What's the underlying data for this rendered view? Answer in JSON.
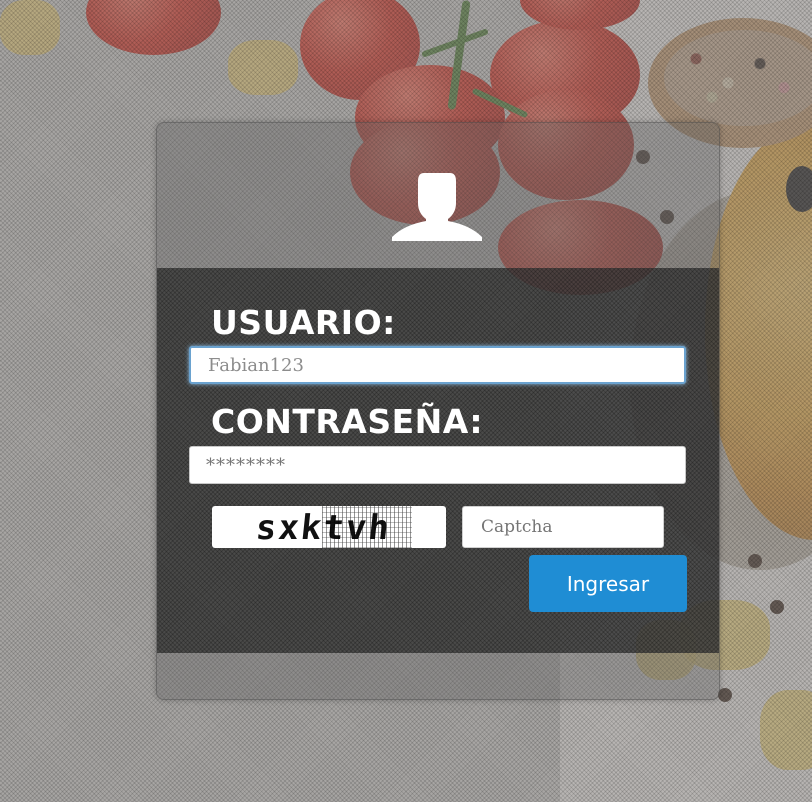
{
  "form": {
    "user_label": "USUARIO:",
    "user_value": "Fabian123",
    "password_label": "CONTRASEÑA:",
    "password_value": "********",
    "captcha_image_text": "sxktvh",
    "captcha_placeholder": "Captcha",
    "submit_label": "Ingresar"
  },
  "icons": {
    "user": "user-silhouette-icon"
  },
  "colors": {
    "submit_button": "#1f8dd4",
    "label_text": "#ffffff",
    "input_focus_border": "#6aa2cf"
  }
}
